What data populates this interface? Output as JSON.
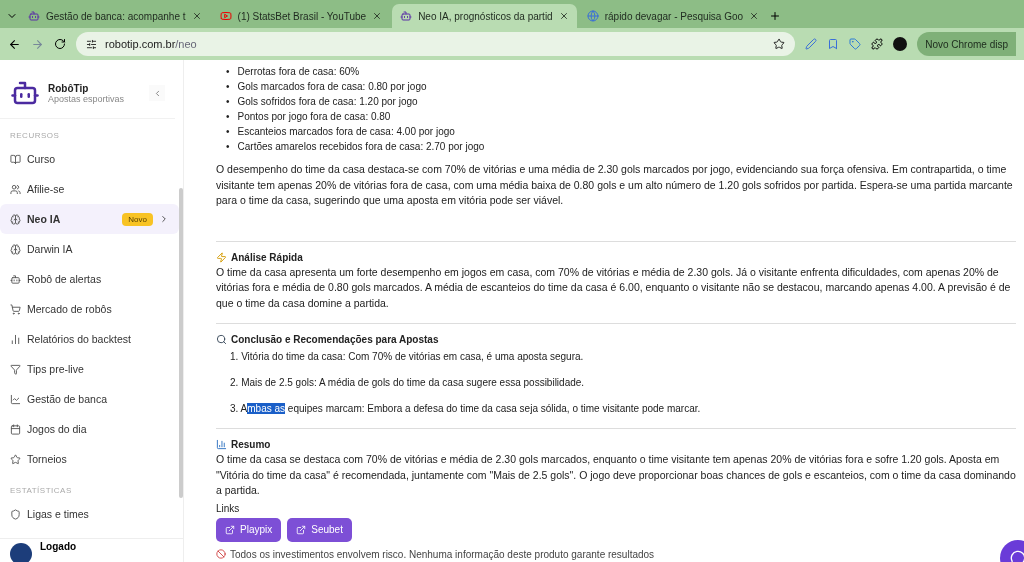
{
  "browser": {
    "tabs": [
      {
        "title": "Gestão de banca: acompanhe t",
        "selected": false
      },
      {
        "title": "(1) StatsBet Brasil - YouTube",
        "selected": false
      },
      {
        "title": "Neo IA, prognósticos da partid",
        "selected": true
      },
      {
        "title": "rápido devagar - Pesquisa Goo",
        "selected": false
      }
    ],
    "url_host": "robotip.com.br",
    "url_path": "/neo",
    "profile_button": "Novo Chrome disp"
  },
  "sidebar": {
    "brand": "RobôTip",
    "tagline": "Apostas esportivas",
    "sections": [
      {
        "title": "RECURSOS",
        "items": [
          {
            "label": "Curso",
            "selected": false
          },
          {
            "label": "Afilie-se",
            "selected": false
          },
          {
            "label": "Neo IA",
            "selected": true,
            "badge": "Novo"
          },
          {
            "label": "Darwin IA",
            "selected": false
          },
          {
            "label": "Robô de alertas",
            "selected": false
          },
          {
            "label": "Mercado de robôs",
            "selected": false
          },
          {
            "label": "Relatórios do backtest",
            "selected": false
          },
          {
            "label": "Tips pre-live",
            "selected": false
          },
          {
            "label": "Gestão de banca",
            "selected": false
          },
          {
            "label": "Jogos do dia",
            "selected": false
          },
          {
            "label": "Torneios",
            "selected": false
          }
        ]
      },
      {
        "title": "ESTATÍSTICAS",
        "items": [
          {
            "label": "Ligas e times",
            "selected": false
          }
        ]
      }
    ],
    "user": "Logado"
  },
  "content": {
    "bullet": "•",
    "bullets": [
      "Derrotas fora de casa: 60%",
      "Gols marcados fora de casa: 0.80 por jogo",
      "Gols sofridos fora de casa: 1.20 por jogo",
      "Pontos por jogo fora de casa: 0.80",
      "Escanteios marcados fora de casa: 4.00 por jogo",
      "Cartões amarelos recebidos fora de casa: 2.70 por jogo"
    ],
    "intro": "O desempenho do time da casa destaca-se com 70% de vitórias e uma média de 2.30 gols marcados por jogo, evidenciando sua força ofensiva. Em contrapartida, o time visitante tem apenas 20% de vitórias fora de casa, com uma média baixa de 0.80 gols e um alto número de 1.20 gols sofridos por partida. Espera-se uma partida marcante para o time da casa, sugerindo que uma aposta em vitória pode ser viável.",
    "sections": [
      {
        "title": "Análise Rápida",
        "kind": "text",
        "text": "O time da casa apresenta um forte desempenho em jogos em casa, com 70% de vitórias e média de 2.30 gols. Já o visitante enfrenta dificuldades, com apenas 20% de vitórias fora e média de 0.80 gols marcados. A média de escanteios do time da casa é 6.00, enquanto o visitante não se destacou, marcando apenas 4.00. A previsão é de que o time da casa domine a partida."
      },
      {
        "title": "Conclusão e Recomendações para Apostas",
        "kind": "list",
        "items": [
          {
            "number": "1.",
            "before": "Vitória do time da casa: Com 70% de vitórias em casa, é uma aposta segura."
          },
          {
            "number": "2.",
            "before": "Mais de 2.5 gols: A média de gols do time da casa sugere essa possibilidade."
          },
          {
            "number": "3.",
            "before": "A",
            "highlight": "mbas as",
            "after": " equipes marcam: Embora a defesa do time da casa seja sólida, o time visitante pode marcar."
          }
        ]
      },
      {
        "title": "Resumo",
        "kind": "text",
        "text": "O time da casa se destaca com 70% de vitórias e média de 2.30 gols marcados, enquanto o time visitante tem apenas 20% de vitórias fora e sofre 1.20 gols. Aposta em \"Vitória do time da casa\" é recomendada, juntamente com \"Mais de 2.5 gols\". O jogo deve proporcionar boas chances de gols e escanteios, com o time da casa dominando a partida."
      }
    ],
    "links_title": "Links",
    "links": [
      "Playpix",
      "Seubet"
    ],
    "disclaimer": "Todos os investimentos envolvem risco. Nenhuma informação deste produto garante resultados"
  }
}
